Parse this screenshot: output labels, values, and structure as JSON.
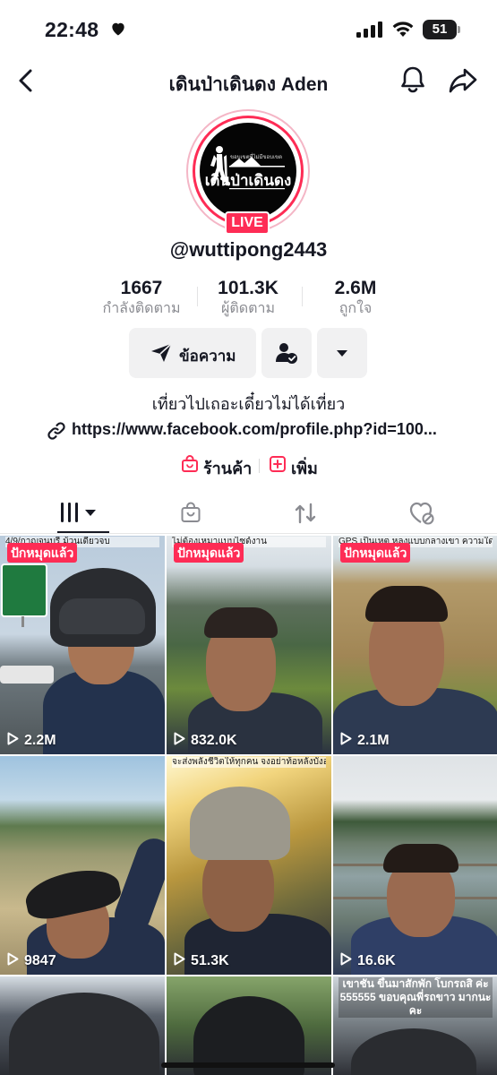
{
  "status_bar": {
    "time": "22:48",
    "battery": "51"
  },
  "header": {
    "title": "เดินป่าเดินดง Aden"
  },
  "profile": {
    "avatar_small_text": "ขอบเขตที่ไม่มีขอบเขต",
    "avatar_text": "เดินป่าเดินดง",
    "live_label": "LIVE",
    "username": "@wuttipong2443",
    "bio": "เที่ยวไปเถอะเดี๋ยวไม่ได้เที่ยว",
    "link": "https://www.facebook.com/profile.php?id=100..."
  },
  "stats": [
    {
      "value": "1667",
      "label": "กำลังติดตาม"
    },
    {
      "value": "101.3K",
      "label": "ผู้ติดตาม"
    },
    {
      "value": "2.6M",
      "label": "ถูกใจ"
    }
  ],
  "actions": {
    "message_label": "ข้อความ"
  },
  "shortcuts": {
    "shop_label": "ร้านค้า",
    "add_label": "เพิ่ม"
  },
  "colors": {
    "accent": "#fe2c55",
    "text": "#161823",
    "muted": "#8a8b91",
    "button_bg": "#f1f1f2"
  },
  "tabs": [
    {
      "icon": "videos-grid-icon"
    },
    {
      "icon": "shop-bag-icon"
    },
    {
      "icon": "repost-icon"
    },
    {
      "icon": "liked-hidden-icon"
    }
  ],
  "videos": [
    {
      "views": "2.2M",
      "pinned": true,
      "pin_label": "ปักหมุดแล้ว",
      "caption": "4/9/กาญจนบุรี ม้วนเดียวจบ"
    },
    {
      "views": "832.0K",
      "pinned": true,
      "pin_label": "ปักหมุดแล้ว",
      "caption": "ไม่ต้องเหมาแบบไซด์งาน"
    },
    {
      "views": "2.1M",
      "pinned": true,
      "pin_label": "ปักหมุดแล้ว",
      "caption": "GPS เป็นเหตุ หลงแบบกลางเขา ความใดใด"
    },
    {
      "views": "9847",
      "pinned": false,
      "pin_label": "",
      "caption": ""
    },
    {
      "views": "51.3K",
      "pinned": false,
      "pin_label": "",
      "caption": "จะส่งพลังชีวิตให้ทุกคน จงอย่าท้อหลังบังอุปสรรค ใจตัวเอง"
    },
    {
      "views": "16.6K",
      "pinned": false,
      "pin_label": "",
      "caption": ""
    },
    {
      "views": "",
      "pinned": false,
      "pin_label": "",
      "caption": ""
    },
    {
      "views": "",
      "pinned": false,
      "pin_label": "",
      "caption": ""
    },
    {
      "views": "",
      "pinned": false,
      "pin_label": "",
      "caption": "เขาชัน ขึ้นมาสักพัก โบกรถสิ ค่ะ 555555 ขอบคุณพี่รถขาว มากนะคะ"
    }
  ]
}
